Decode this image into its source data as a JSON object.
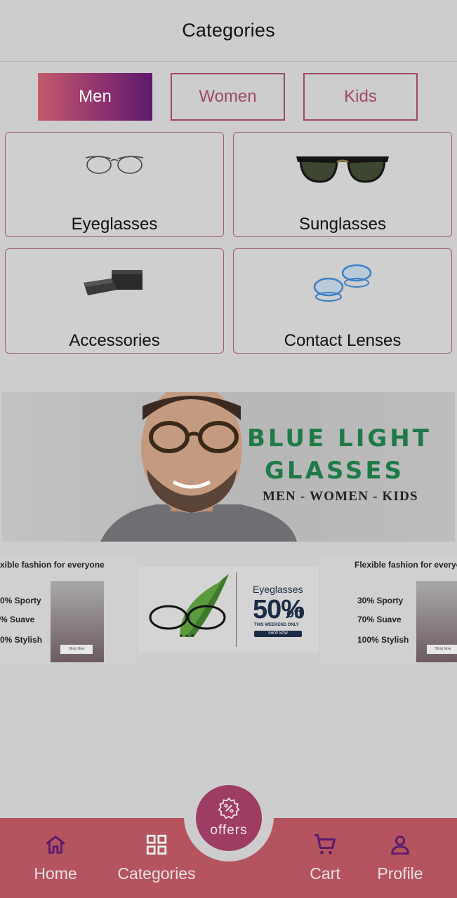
{
  "header": {
    "title": "Categories"
  },
  "tabs": [
    {
      "label": "Men",
      "active": true
    },
    {
      "label": "Women",
      "active": false
    },
    {
      "label": "Kids",
      "active": false
    }
  ],
  "categories": [
    {
      "label": "Eyeglasses",
      "icon": "eyeglasses-icon"
    },
    {
      "label": "Sunglasses",
      "icon": "sunglasses-icon"
    },
    {
      "label": "Accessories",
      "icon": "accessories-icon"
    },
    {
      "label": "Contact Lenses",
      "icon": "contact-lenses-icon"
    }
  ],
  "banner": {
    "line1": "BLUE LIGHT",
    "line2": "GLASSES",
    "line3": "MEN - WOMEN - KIDS"
  },
  "promo_left": {
    "heading": "xible fashion for everyone",
    "rows": [
      "0% Sporty",
      "% Suave",
      "0% Stylish"
    ],
    "shop": "Shop Now"
  },
  "promo_mid": {
    "title": "Eyeglasses",
    "percent": "50%",
    "off": "off",
    "weekend": "THIS WEEKEND ONLY",
    "shop": "SHOP NOW"
  },
  "promo_right": {
    "heading": "Flexible fashion for everyo",
    "rows": [
      "30% Sporty",
      "70% Suave",
      "100% Stylish"
    ],
    "shop": "Shop Now"
  },
  "nav": {
    "home": "Home",
    "categories": "Categories",
    "offers": "offers",
    "cart": "Cart",
    "profile": "Profile"
  },
  "colors": {
    "accent": "#9d4a67",
    "nav_bg": "#b5545f",
    "banner_text": "#1f7a47"
  }
}
